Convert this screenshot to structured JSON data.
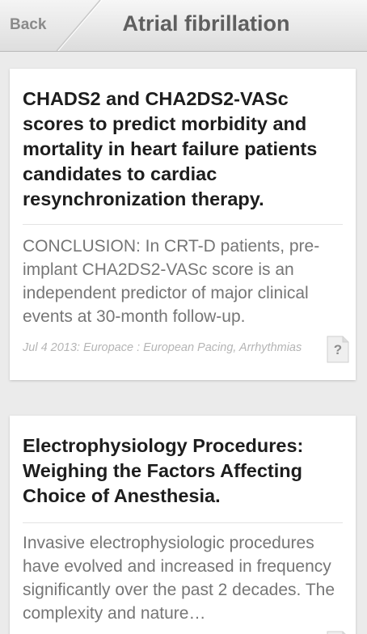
{
  "header": {
    "back_label": "Back",
    "title": "Atrial fibrillation"
  },
  "articles": [
    {
      "title": "CHADS2 and CHA2DS2-VASc scores to predict morbidity and mortality in heart failure patients candidates to cardiac resynchronization therapy.",
      "abstract": "CONCLUSION: In CRT-D patients, pre-implant CHA2DS2-VASc score is an independent predictor of major clinical events at 30-month follow-up.",
      "meta": "Jul 4 2013: Europace : European Pacing, Arrhythmias",
      "doc_icon_glyph": "?",
      "doc_icon": "unknown-document-icon"
    },
    {
      "title": "Electrophysiology Procedures: Weighing the Factors Affecting Choice of Anesthesia.",
      "abstract": "Invasive electrophysiologic procedures have evolved and increased in frequency significantly over the past 2 decades. The complexity and nature…",
      "doc_icon": "document-icon"
    }
  ],
  "colors": {
    "background": "#ebebeb",
    "header_title": "#5f5f5f",
    "card_title": "#1d1d1d",
    "abstract": "#767676",
    "meta": "#b5b5b5"
  }
}
